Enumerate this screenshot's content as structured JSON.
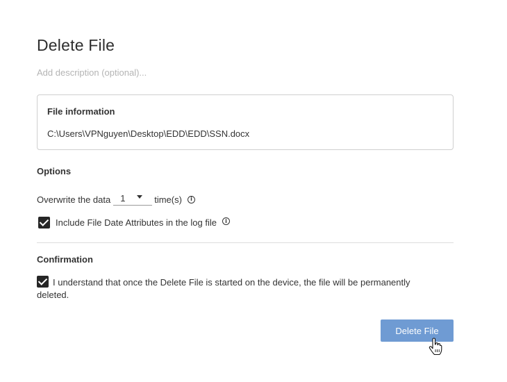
{
  "dialog": {
    "title": "Delete File",
    "description_placeholder": "Add description (optional)..."
  },
  "file_info": {
    "heading": "File information",
    "path": "C:\\Users\\VPNguyen\\Desktop\\EDD\\EDD\\SSN.docx"
  },
  "options": {
    "heading": "Options",
    "overwrite_prefix": "Overwrite the data",
    "overwrite_value": "1",
    "overwrite_suffix": "time(s)",
    "include_attributes_label": "Include File Date Attributes in the log file",
    "include_attributes_checked": true,
    "info_icon": "info-icon"
  },
  "confirmation": {
    "heading": "Confirmation",
    "label": "I understand that once the Delete File is started on the device, the file will be permanently deleted.",
    "checked": true
  },
  "actions": {
    "delete_label": "Delete File"
  },
  "colors": {
    "primary_button": "#6f9bd3",
    "checkbox": "#262626",
    "border": "#cfcfcf",
    "placeholder": "#b4b4b4"
  }
}
